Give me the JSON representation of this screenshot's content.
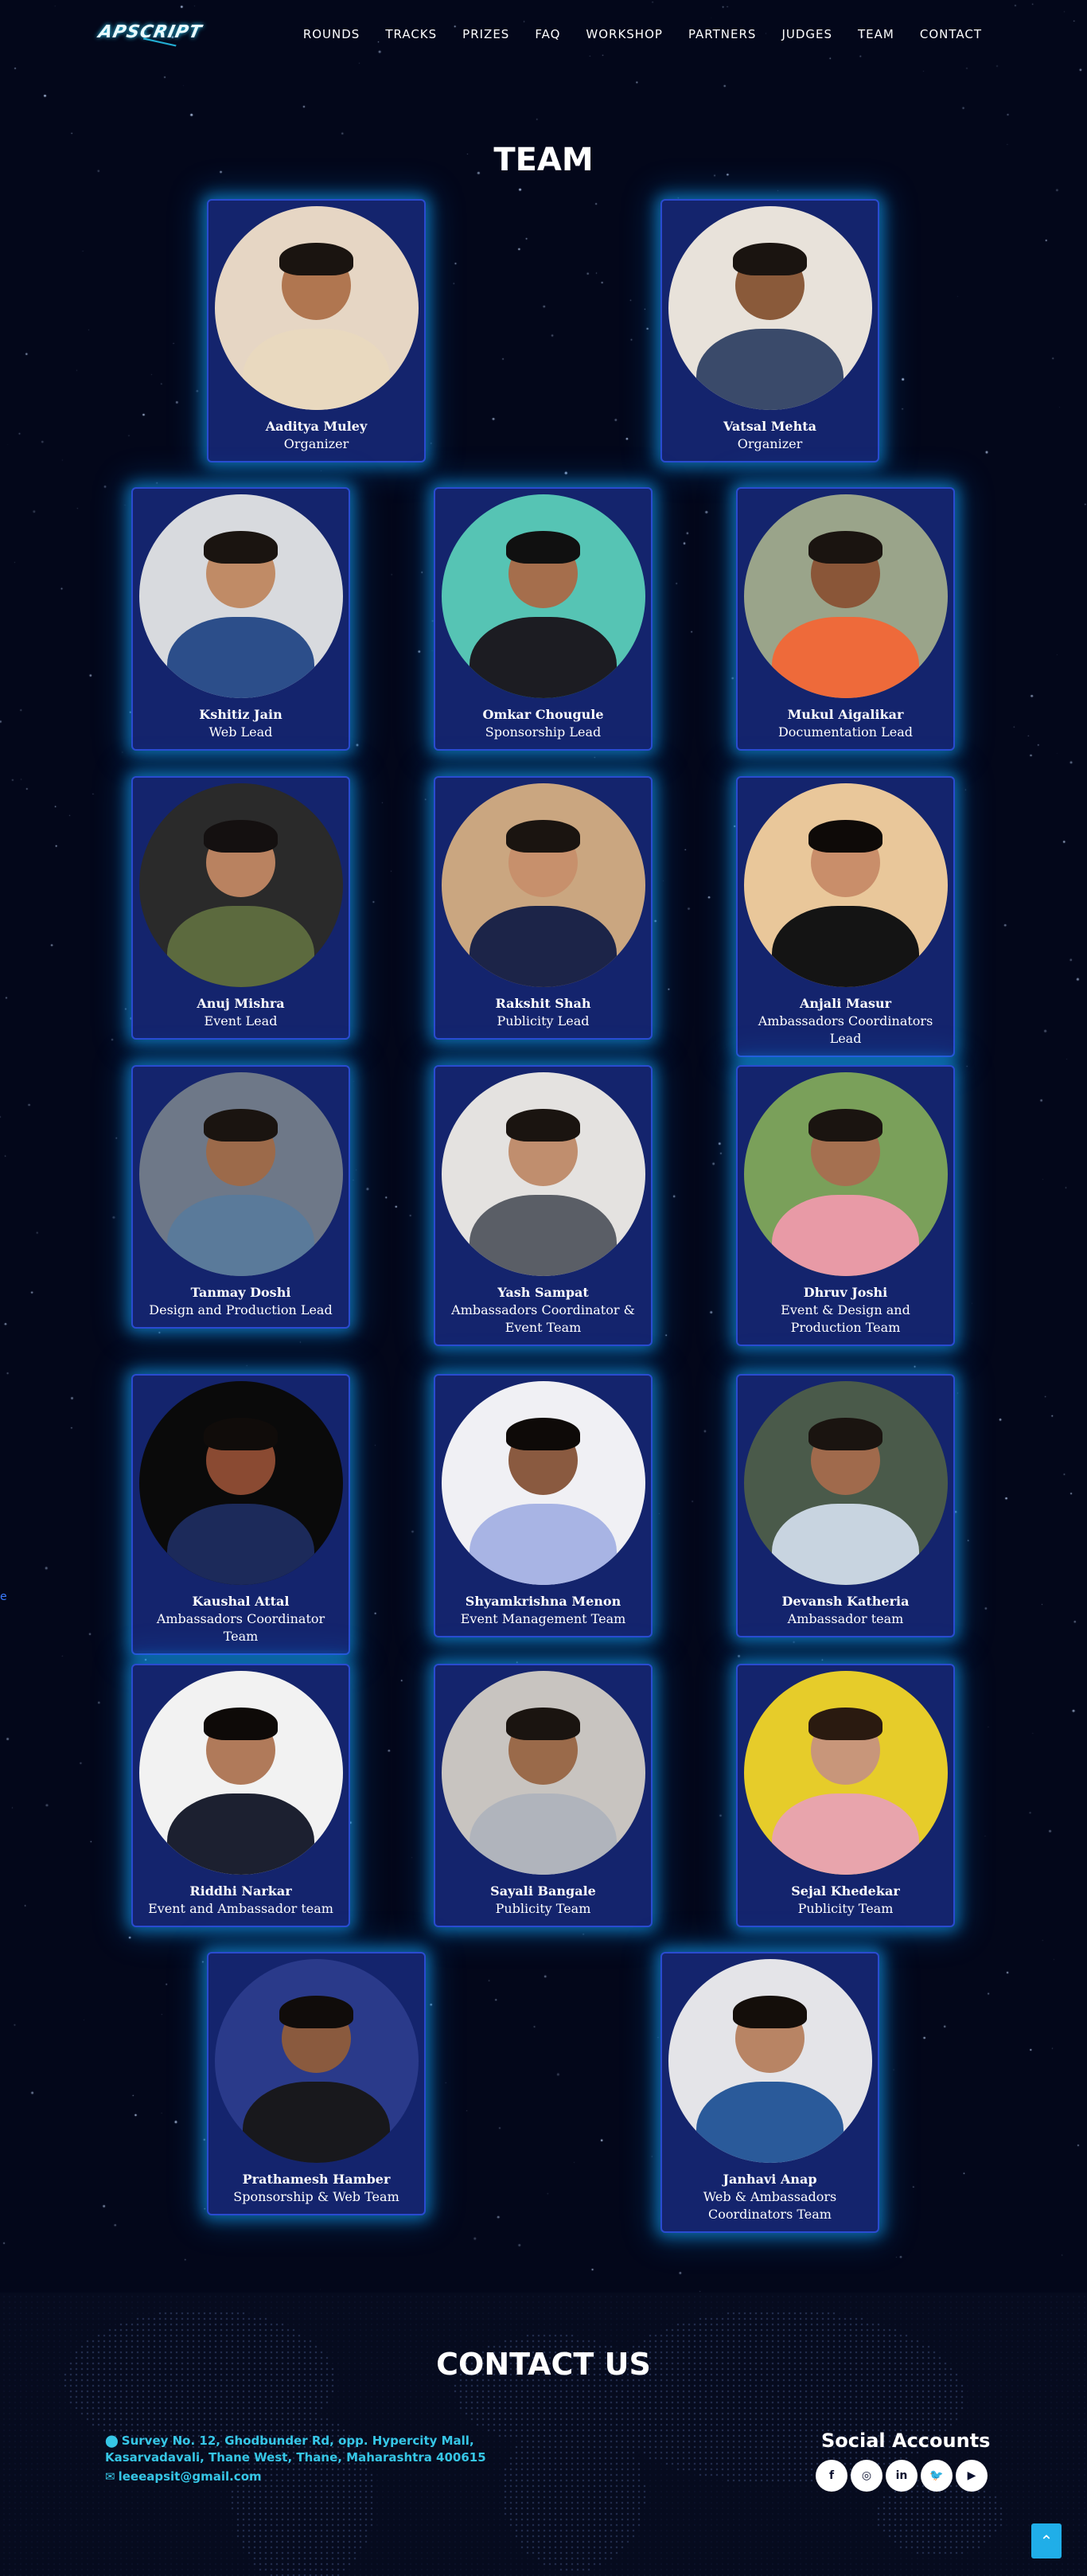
{
  "nav": {
    "logo": "APSCRIPT",
    "items": [
      "ROUNDS",
      "TRACKS",
      "PRIZES",
      "FAQ",
      "WORKSHOP",
      "PARTNERS",
      "JUDGES",
      "TEAM",
      "CONTACT"
    ]
  },
  "team": {
    "title": "TEAM",
    "members": [
      {
        "name": "Aaditya Muley",
        "role": "Organizer",
        "palette": {
          "bg": "#e6d6c4",
          "skin": "#b07650",
          "shirt": "#e9d9bf",
          "hair": "#1a1410"
        }
      },
      {
        "name": "Vatsal Mehta",
        "role": "Organizer",
        "palette": {
          "bg": "#e8e2da",
          "skin": "#8a5a3a",
          "shirt": "#3a4a6a",
          "hair": "#1a1410"
        }
      },
      {
        "name": "Kshitiz Jain",
        "role": "Web Lead",
        "palette": {
          "bg": "#d8dade",
          "skin": "#c08b66",
          "shirt": "#2c4e8a",
          "hair": "#1a1410"
        }
      },
      {
        "name": "Omkar Chougule",
        "role": "Sponsorship Lead",
        "palette": {
          "bg": "#56c4b4",
          "skin": "#a56e4c",
          "shirt": "#1c1c22",
          "hair": "#101010"
        }
      },
      {
        "name": "Mukul Aigalikar",
        "role": "Documentation Lead",
        "palette": {
          "bg": "#9aa48a",
          "skin": "#8a5638",
          "shirt": "#ee6a3a",
          "hair": "#1a1410"
        }
      },
      {
        "name": "Anuj Mishra",
        "role": "Event Lead",
        "palette": {
          "bg": "#2a2a2a",
          "skin": "#b98260",
          "shirt": "#5c6a3e",
          "hair": "#141010"
        }
      },
      {
        "name": "Rakshit Shah",
        "role": "Publicity Lead",
        "palette": {
          "bg": "#caa680",
          "skin": "#c7906c",
          "shirt": "#1c2448",
          "hair": "#1a1410"
        }
      },
      {
        "name": "Anjali Masur",
        "role": "Ambassadors Coordinators Lead",
        "palette": {
          "bg": "#e9c79a",
          "skin": "#c98e6a",
          "shirt": "#141414",
          "hair": "#0e0a08"
        }
      },
      {
        "name": "Tanmay Doshi",
        "role": "Design and Production Lead",
        "palette": {
          "bg": "#6e7888",
          "skin": "#9c6a4a",
          "shirt": "#5a7a9a",
          "hair": "#1a1410"
        }
      },
      {
        "name": "Yash Sampat",
        "role": "Ambassadors Coordinator & Event Team",
        "palette": {
          "bg": "#e4e2e0",
          "skin": "#c08e6e",
          "shirt": "#5a5e66",
          "hair": "#1a1410"
        }
      },
      {
        "name": "Dhruv Joshi",
        "role": "Event & Design and Production Team",
        "palette": {
          "bg": "#7aa05a",
          "skin": "#a57050",
          "shirt": "#e89aa6",
          "hair": "#1a1410"
        }
      },
      {
        "name": "Kaushal Attal",
        "role": "Ambassadors Coordinator Team",
        "palette": {
          "bg": "#0a0a0a",
          "skin": "#8a4a32",
          "shirt": "#1c2a5a",
          "hair": "#100c0a"
        }
      },
      {
        "name": "Shyamkrishna Menon",
        "role": "Event Management Team",
        "palette": {
          "bg": "#f0f0f4",
          "skin": "#8a5a40",
          "shirt": "#a8b4e4",
          "hair": "#0e0a08"
        }
      },
      {
        "name": "Devansh Katheria",
        "role": "Ambassador team",
        "palette": {
          "bg": "#4a5a4a",
          "skin": "#a06a4c",
          "shirt": "#c8d4e0",
          "hair": "#1a1410"
        }
      },
      {
        "name": "Riddhi Narkar",
        "role": "Event and Ambassador team",
        "palette": {
          "bg": "#f2f2f2",
          "skin": "#b07a5a",
          "shirt": "#1c2030",
          "hair": "#0e0a08"
        }
      },
      {
        "name": "Sayali Bangale",
        "role": "Publicity Team",
        "palette": {
          "bg": "#c8c4c0",
          "skin": "#9a6a4a",
          "shirt": "#b0b4bc",
          "hair": "#1a1410"
        }
      },
      {
        "name": "Sejal Khedekar",
        "role": "Publicity Team",
        "palette": {
          "bg": "#e6cc2a",
          "skin": "#c8967a",
          "shirt": "#e8a4ac",
          "hair": "#2a1a10"
        }
      },
      {
        "name": "Prathamesh Hamber",
        "role": "Sponsorship & Web Team",
        "palette": {
          "bg": "#2a3a8a",
          "skin": "#8a5a3e",
          "shirt": "#18181c",
          "hair": "#100c0a"
        }
      },
      {
        "name": "Janhavi Anap",
        "role": "Web & Ambassadors Coordinators Team",
        "palette": {
          "bg": "#e4e4e8",
          "skin": "#b88464",
          "shirt": "#2a5a9a",
          "hair": "#140e0a"
        }
      }
    ]
  },
  "contact": {
    "title": "CONTACT US",
    "address": "Survey No. 12, Ghodbunder Rd, opp. Hypercity Mall, Kasarvadavali, Thane West, Thane, Maharashtra 400615",
    "email": "leeeapsit@gmail.com",
    "social_title": "Social Accounts",
    "social_icons": [
      {
        "icon": "facebook-icon",
        "glyph": "f"
      },
      {
        "icon": "instagram-icon",
        "glyph": "◎"
      },
      {
        "icon": "linkedin-icon",
        "glyph": "in"
      },
      {
        "icon": "twitter-icon",
        "glyph": "🐦"
      },
      {
        "icon": "youtube-icon",
        "glyph": "▶"
      }
    ]
  },
  "side_letter": "e",
  "colors": {
    "accent": "#36c6e6",
    "card": "#14246d",
    "glow": "#14aaff",
    "background": "#03071a"
  }
}
